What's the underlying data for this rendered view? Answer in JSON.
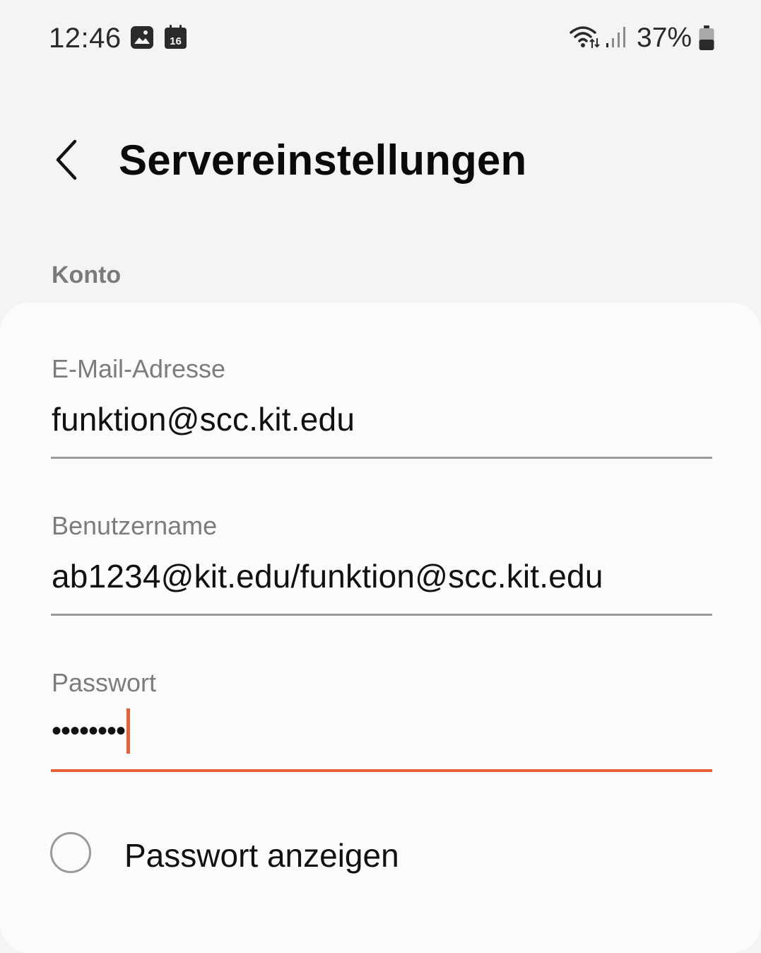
{
  "status_bar": {
    "time": "12:46",
    "calendar_date": "16",
    "battery_percent": "37%",
    "icons": [
      "gallery-icon",
      "calendar-icon",
      "wifi-icon",
      "signal-icon",
      "battery-icon"
    ]
  },
  "header": {
    "back_icon": "chevron-left-icon",
    "title": "Servereinstellungen"
  },
  "section": {
    "title": "Konto"
  },
  "form": {
    "email": {
      "label": "E-Mail-Adresse",
      "value": "funktion@scc.kit.edu"
    },
    "username": {
      "label": "Benutzername",
      "value": "ab1234@kit.edu/funktion@scc.kit.edu"
    },
    "password": {
      "label": "Passwort",
      "masked_value": "••••••••"
    },
    "show_password": {
      "label": "Passwort anzeigen",
      "checked": false
    }
  },
  "colors": {
    "background": "#f4f4f4",
    "card": "#fbfbfb",
    "accent": "#e8603a",
    "label": "#7c7c7c",
    "underline": "#9a9a9a"
  }
}
